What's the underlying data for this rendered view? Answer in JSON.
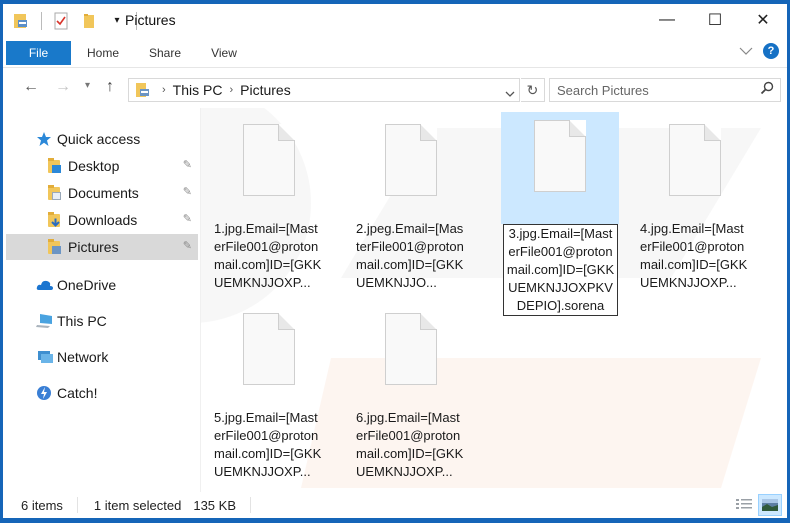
{
  "window": {
    "title": "Pictures",
    "controls": {
      "minimize": "—",
      "maximize": "☐",
      "close": "✕"
    }
  },
  "ribbon": {
    "tabs": [
      {
        "label": "File",
        "active": true
      },
      {
        "label": "Home"
      },
      {
        "label": "Share"
      },
      {
        "label": "View"
      }
    ],
    "help_glyph": "?",
    "expand_glyph": "⌄"
  },
  "navigation": {
    "back_glyph": "←",
    "forward_glyph": "→",
    "recent_glyph": "⌄",
    "up_glyph": "↑",
    "breadcrumb": [
      "This PC",
      "Pictures"
    ],
    "breadcrumb_sep": "›",
    "refresh_glyph": "↻",
    "search_placeholder": "Search Pictures"
  },
  "sidebar": {
    "items": [
      {
        "label": "Quick access",
        "icon": "star-icon"
      },
      {
        "label": "Desktop",
        "icon": "desktop-folder-icon",
        "pinned": true
      },
      {
        "label": "Documents",
        "icon": "documents-folder-icon",
        "pinned": true
      },
      {
        "label": "Downloads",
        "icon": "downloads-folder-icon",
        "pinned": true
      },
      {
        "label": "Pictures",
        "icon": "pictures-folder-icon",
        "pinned": true,
        "selected": true
      },
      {
        "label": "OneDrive",
        "icon": "onedrive-cloud-icon"
      },
      {
        "label": "This PC",
        "icon": "computer-icon"
      },
      {
        "label": "Network",
        "icon": "network-icon"
      },
      {
        "label": "Catch!",
        "icon": "catch-icon"
      }
    ],
    "pin_glyph": "📌"
  },
  "files": [
    {
      "name": "1.jpg.Email=[MasterFile001@protonmail.com]ID=[GKKUEMKNJJOXP...",
      "selected": false
    },
    {
      "name": "2.jpeg.Email=[MasterFile001@protonmail.com]ID=[GKKUEMKNJJO...",
      "selected": false
    },
    {
      "name": "3.jpg.Email=[MasterFile001@protonmail.com]ID=[GKKUEMKNJJOXPKVDEPIO].sorena",
      "selected": true
    },
    {
      "name": "4.jpg.Email=[MasterFile001@protonmail.com]ID=[GKKUEMKNJJOXP...",
      "selected": false
    },
    {
      "name": "5.jpg.Email=[MasterFile001@protonmail.com]ID=[GKKUEMKNJJOXP...",
      "selected": false
    },
    {
      "name": "6.jpg.Email=[MasterFile001@protonmail.com]ID=[GKKUEMKNJJOXP...",
      "selected": false
    }
  ],
  "status": {
    "item_count": "6 items",
    "selection": "1 item selected",
    "size": "135 KB"
  },
  "colors": {
    "accent": "#1979ca",
    "frame": "#1565b8",
    "selection": "#cce8ff"
  }
}
